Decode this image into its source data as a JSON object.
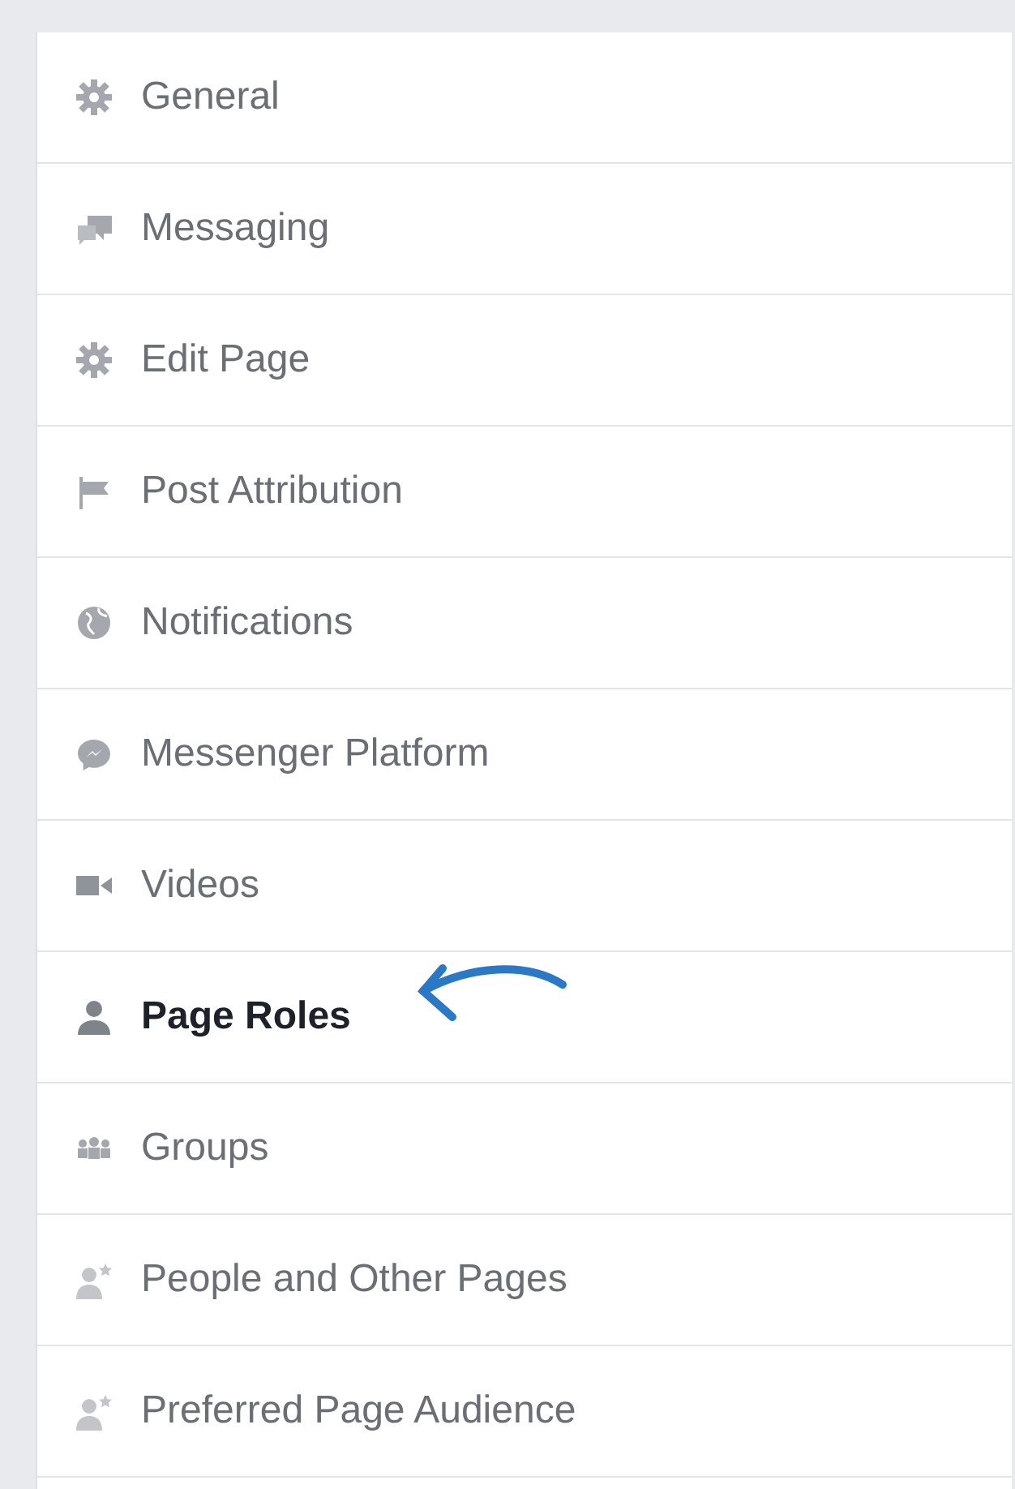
{
  "menu": [
    {
      "label": "General",
      "kind": "gear",
      "selected": false
    },
    {
      "label": "Messaging",
      "kind": "chat",
      "selected": false
    },
    {
      "label": "Edit Page",
      "kind": "gear",
      "selected": false
    },
    {
      "label": "Post Attribution",
      "kind": "flag",
      "selected": false
    },
    {
      "label": "Notifications",
      "kind": "globe",
      "selected": false
    },
    {
      "label": "Messenger Platform",
      "kind": "messenger",
      "selected": false
    },
    {
      "label": "Videos",
      "kind": "video",
      "selected": false
    },
    {
      "label": "Page Roles",
      "kind": "person",
      "selected": true
    },
    {
      "label": "Groups",
      "kind": "group",
      "selected": false
    },
    {
      "label": "People and Other Pages",
      "kind": "personstar",
      "selected": false
    },
    {
      "label": "Preferred Page Audience",
      "kind": "personstar",
      "selected": false
    }
  ]
}
